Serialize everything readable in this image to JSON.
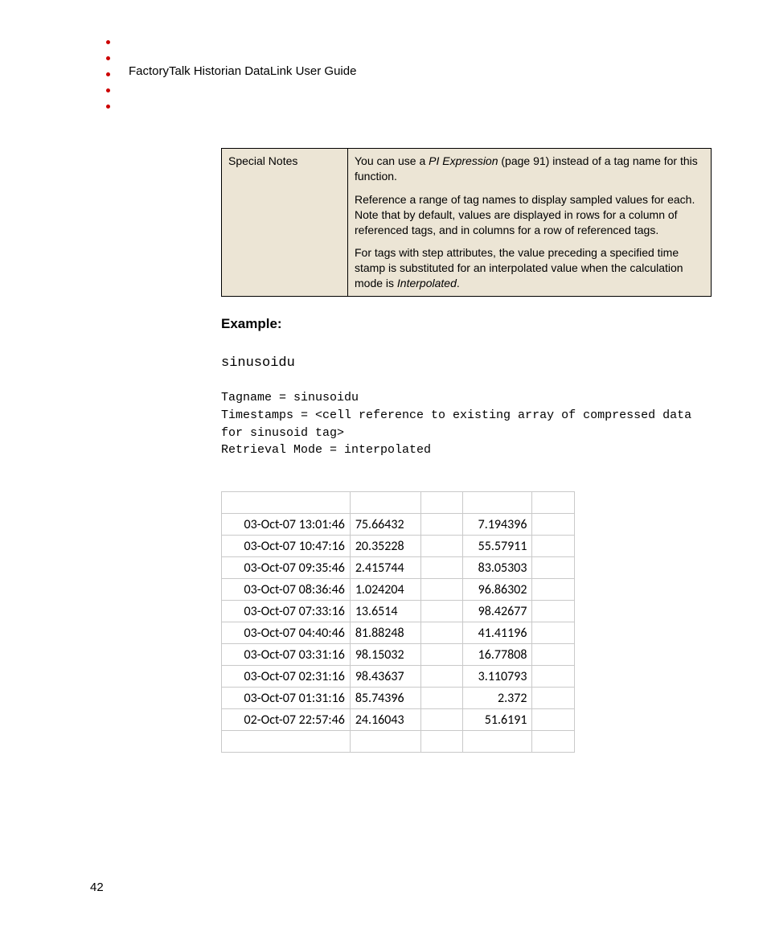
{
  "header": {
    "title": "FactoryTalk Historian DataLink User Guide"
  },
  "notes": {
    "label": "Special Notes",
    "p1a": "You can use a ",
    "p1b": "PI Expression",
    "p1c": " (page 91) instead of a tag name for this function.",
    "p2": "Reference a range of tag names to display sampled values for each. Note that by default, values are displayed in rows for a column of referenced tags, and in columns for a row of referenced tags.",
    "p3a": "For tags with step attributes, the value preceding a specified time stamp is substituted for an interpolated value when the calculation mode is ",
    "p3b": "Interpolated",
    "p3c": "."
  },
  "example": {
    "heading": "Example:",
    "tag": "sinusoidu",
    "params": "Tagname = sinusoidu\nTimestamps = <cell reference to existing array of compressed data for sinusoid tag>\nRetrieval Mode = interpolated"
  },
  "grid": {
    "rows": [
      {
        "ts": "03-Oct-07 13:01:46",
        "v1": "75.66432",
        "v2": "7.194396"
      },
      {
        "ts": "03-Oct-07 10:47:16",
        "v1": "20.35228",
        "v2": "55.57911"
      },
      {
        "ts": "03-Oct-07 09:35:46",
        "v1": "2.415744",
        "v2": "83.05303"
      },
      {
        "ts": "03-Oct-07 08:36:46",
        "v1": "1.024204",
        "v2": "96.86302"
      },
      {
        "ts": "03-Oct-07 07:33:16",
        "v1": "13.6514",
        "v2": "98.42677"
      },
      {
        "ts": "03-Oct-07 04:40:46",
        "v1": "81.88248",
        "v2": "41.41196"
      },
      {
        "ts": "03-Oct-07 03:31:16",
        "v1": "98.15032",
        "v2": "16.77808"
      },
      {
        "ts": "03-Oct-07 02:31:16",
        "v1": "98.43637",
        "v2": "3.110793"
      },
      {
        "ts": "03-Oct-07 01:31:16",
        "v1": "85.74396",
        "v2": "2.372"
      },
      {
        "ts": "02-Oct-07 22:57:46",
        "v1": "24.16043",
        "v2": "51.6191"
      }
    ]
  },
  "pageNumber": "42"
}
